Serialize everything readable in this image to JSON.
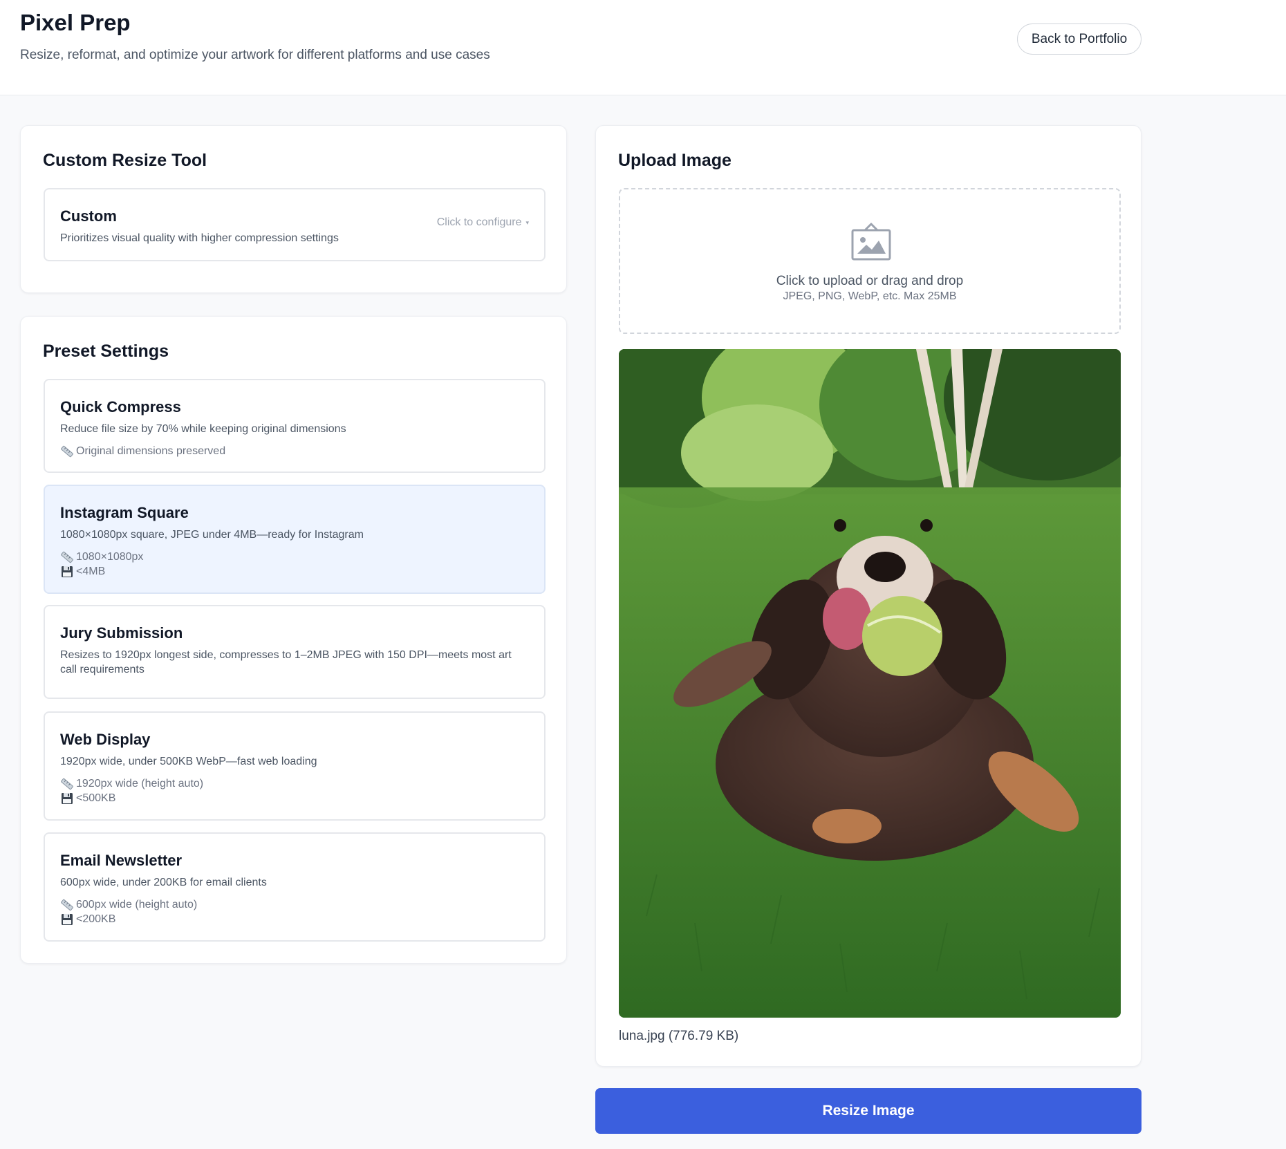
{
  "header": {
    "title": "Pixel Prep",
    "subtitle": "Resize, reformat, and optimize your artwork for different platforms and use cases",
    "back_label": "Back to Portfolio"
  },
  "custom_tool": {
    "title": "Custom Resize Tool",
    "option": {
      "title": "Custom",
      "description": "Prioritizes visual quality with higher compression settings",
      "configure_label": "Click to configure",
      "configure_caret": "▾"
    }
  },
  "presets": {
    "title": "Preset Settings",
    "items": [
      {
        "title": "Quick Compress",
        "description": "Reduce file size by 70% while keeping original dimensions",
        "dimensions": "Original dimensions preserved",
        "selected": false
      },
      {
        "title": "Instagram Square",
        "description": "1080×1080px square, JPEG under 4MB—ready for Instagram",
        "dimensions": "1080×1080px",
        "size": "<4MB",
        "selected": true
      },
      {
        "title": "Jury Submission",
        "description": "Resizes to 1920px longest side, compresses to 1–2MB JPEG with 150 DPI—meets most art call requirements",
        "selected": false
      },
      {
        "title": "Web Display",
        "description": "1920px wide, under 500KB WebP—fast web loading",
        "dimensions": "1920px wide (height auto)",
        "size": "<500KB",
        "selected": false
      },
      {
        "title": "Email Newsletter",
        "description": "600px wide, under 200KB for email clients",
        "dimensions": "600px wide (height auto)",
        "size": "<200KB",
        "selected": false
      }
    ]
  },
  "upload": {
    "title": "Upload Image",
    "drop_text": "Click to upload or drag and drop",
    "drop_subtext": "JPEG, PNG, WebP, etc. Max 25MB",
    "file_info": "luna.jpg (776.79 KB)"
  },
  "actions": {
    "resize_label": "Resize Image"
  },
  "icons": {
    "ruler": "ruler-icon",
    "disk": "floppy-disk-icon",
    "upload": "image-upload-icon"
  },
  "colors": {
    "primary": "#3b5fde",
    "selected_bg": "#eef4ff",
    "page_bg": "#f8f9fb"
  }
}
